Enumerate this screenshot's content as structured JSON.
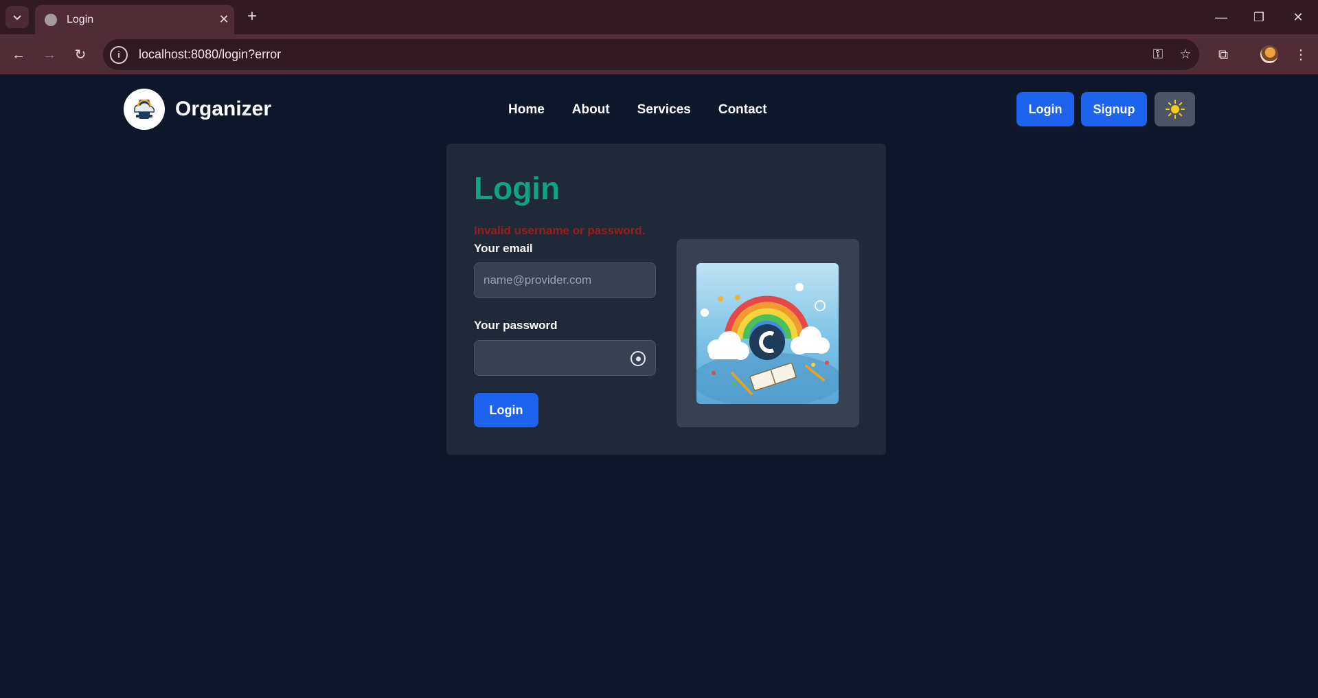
{
  "browser": {
    "tab_title": "Login",
    "url": "localhost:8080/login?error"
  },
  "site": {
    "brand": "Organizer",
    "nav": [
      "Home",
      "About",
      "Services",
      "Contact"
    ],
    "login_button": "Login",
    "signup_button": "Signup"
  },
  "login_card": {
    "title": "Login",
    "error": "Invalid username or password.",
    "email_label": "Your email",
    "email_placeholder": "name@provider.com",
    "password_label": "Your password",
    "password_value": "",
    "submit": "Login"
  },
  "colors": {
    "accent_blue": "#1d63ed",
    "title_green": "#10a37f",
    "error_red": "#991b1b",
    "page_bg": "#0f172a",
    "card_bg": "#1f2937"
  }
}
